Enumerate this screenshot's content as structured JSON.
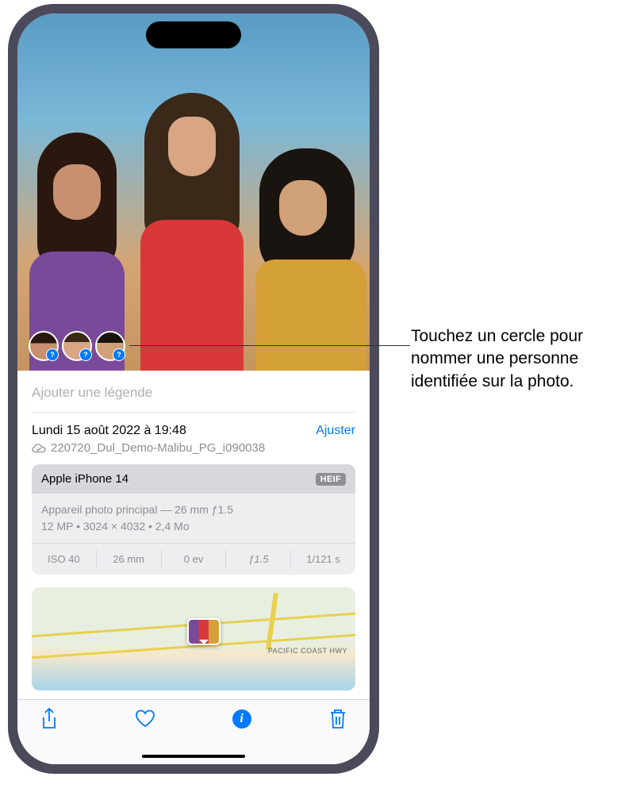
{
  "callout": {
    "text": "Touchez un cercle pour nommer une personne identifiée sur la photo."
  },
  "caption": {
    "placeholder": "Ajouter une légende"
  },
  "date": {
    "text": "Lundi 15 août 2022 à 19:48",
    "adjust_label": "Ajuster"
  },
  "file": {
    "cloud_icon": "cloud-checkmark",
    "filename": "220720_Dul_Demo-Malibu_PG_i090038"
  },
  "camera": {
    "device": "Apple iPhone 14",
    "format": "HEIF",
    "lens": "Appareil photo principal — 26 mm ƒ1.5",
    "resolution_line": "12 MP  •  3024 × 4032  •  2,4 Mo",
    "specs": {
      "iso": "ISO 40",
      "focal": "26 mm",
      "ev": "0 ev",
      "aperture": "ƒ1.5",
      "shutter": "1/121 s"
    }
  },
  "map": {
    "road_label": "PACIFIC COAST HWY"
  },
  "toolbar": {
    "share": "share",
    "favorite": "favorite",
    "info": "info",
    "delete": "delete"
  },
  "faces": {
    "count": 3
  }
}
